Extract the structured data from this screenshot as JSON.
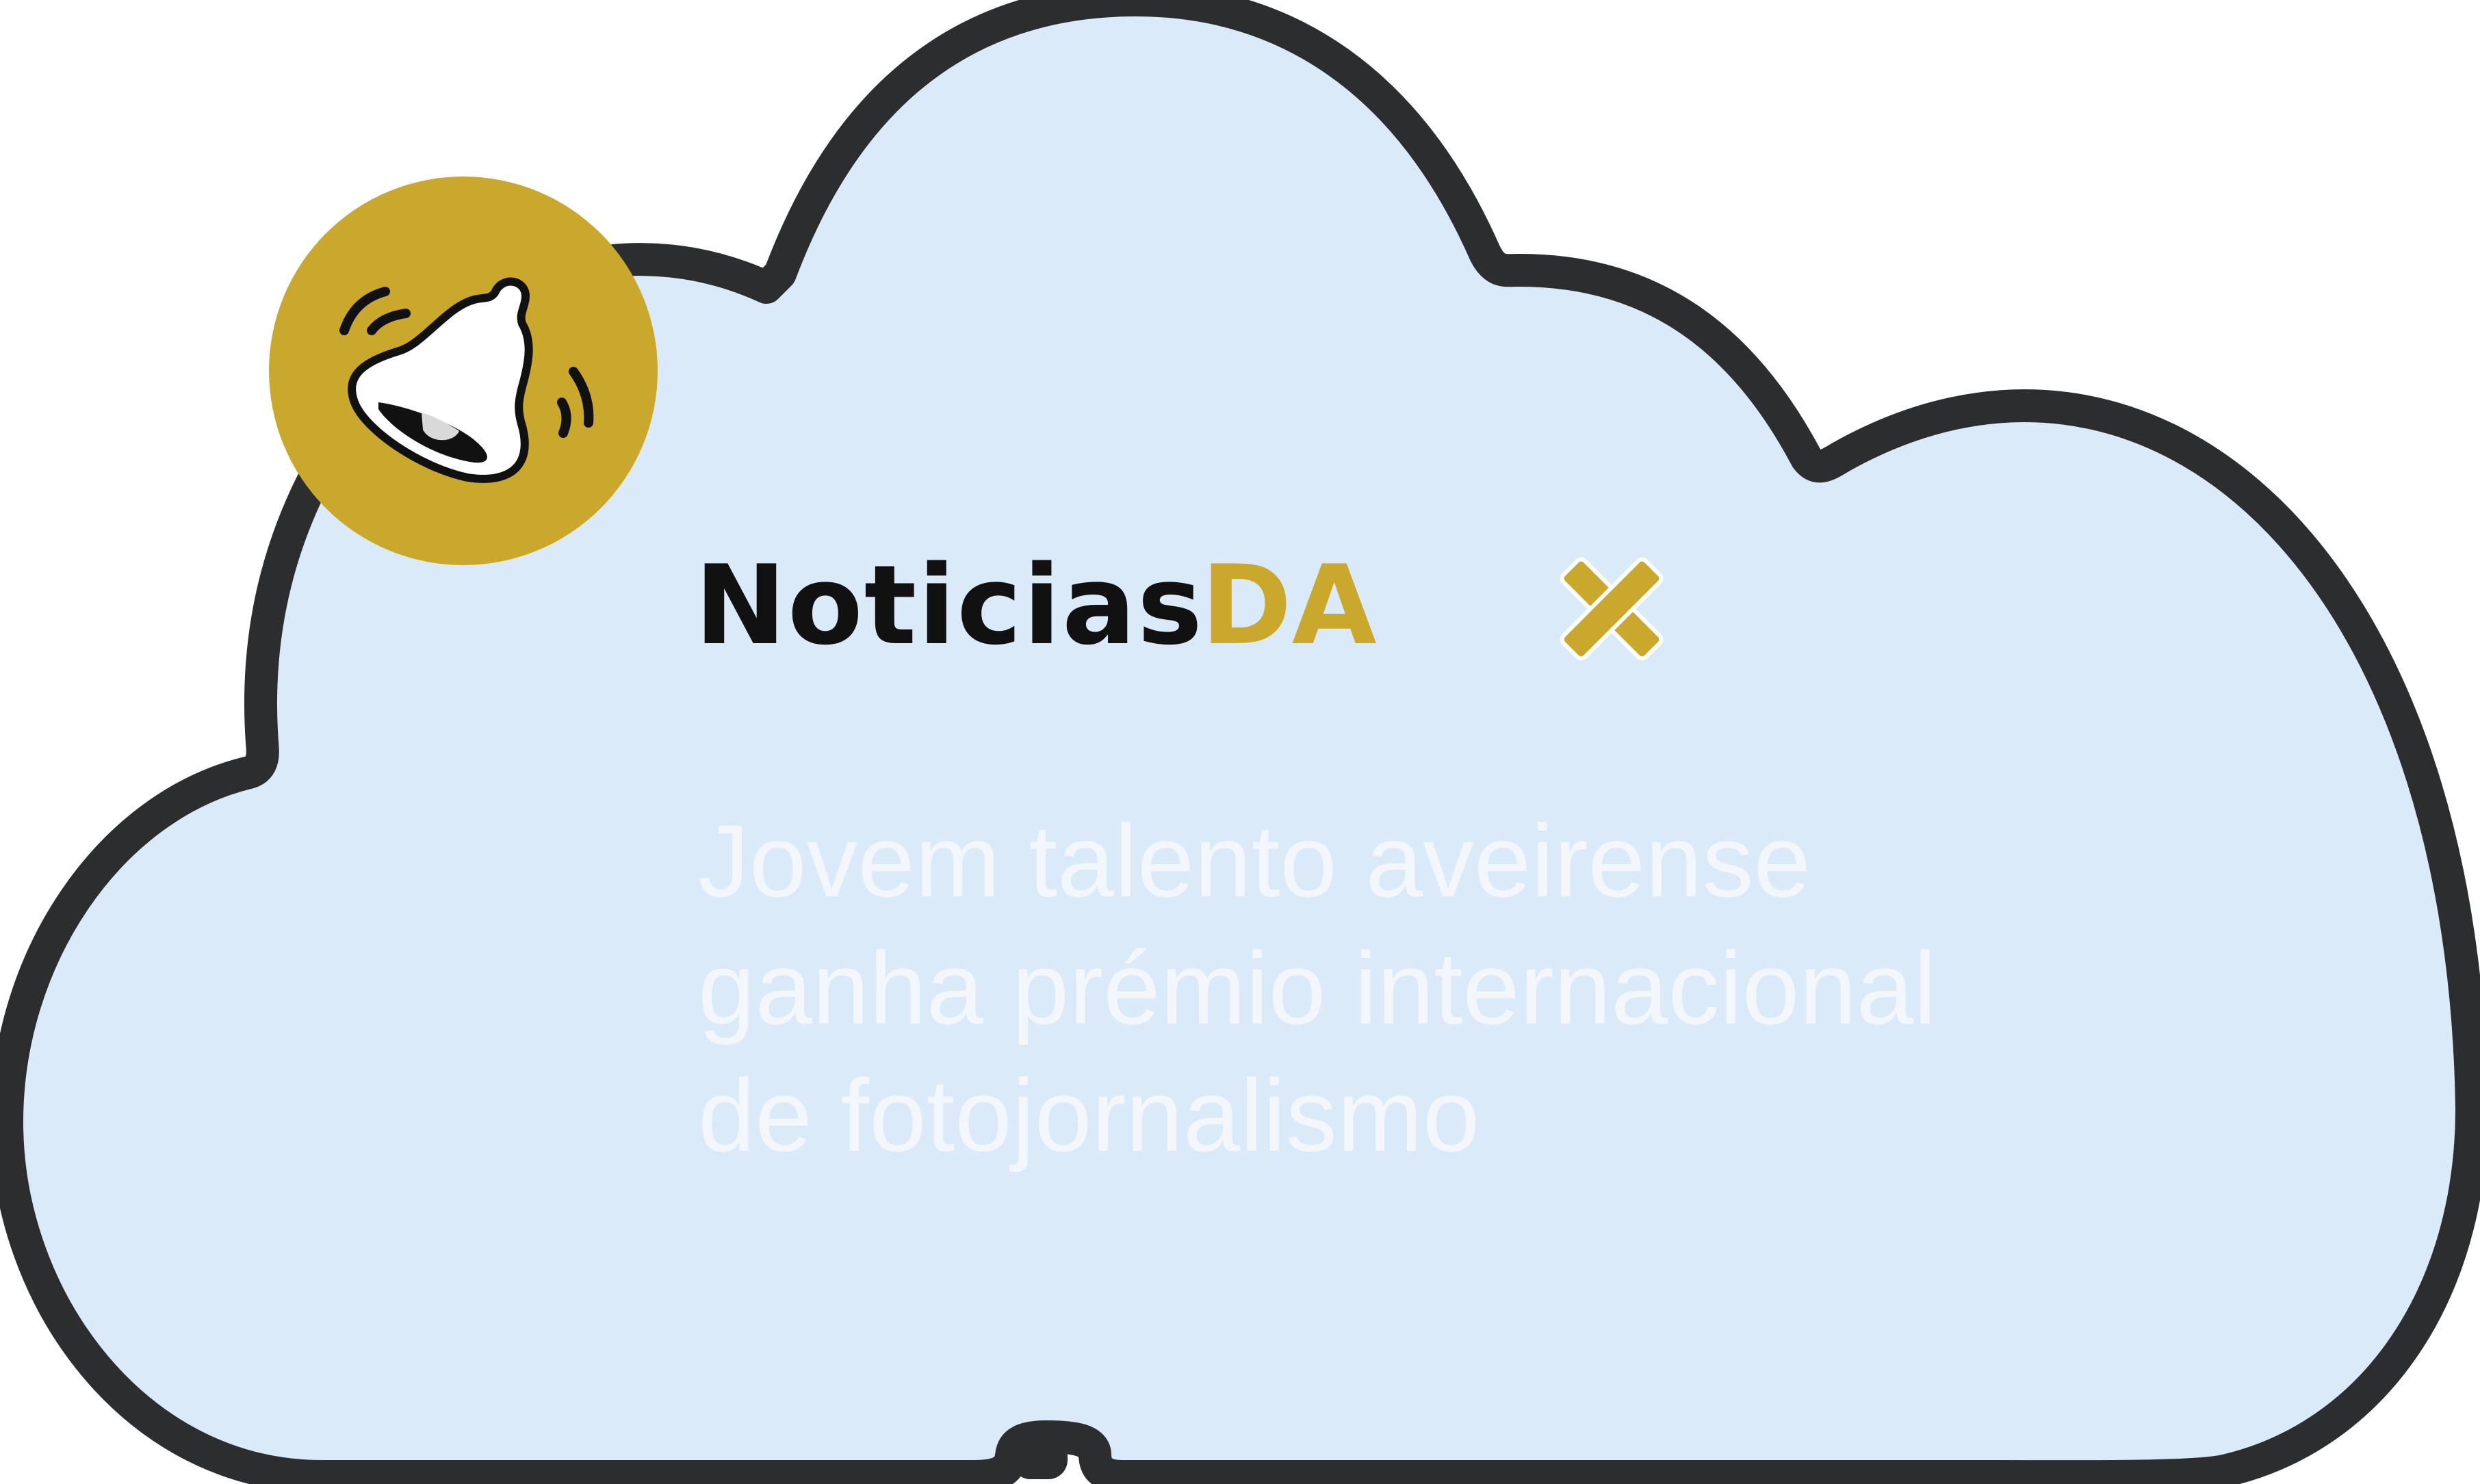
{
  "brand": {
    "word": "Noticias",
    "particle": "DA",
    "mark_label": ""
  },
  "headline": {
    "line1": "Jovem talento aveirense",
    "line2": "ganha prémio internacional",
    "line3": "de fotojornalismo"
  },
  "icons": {
    "badge": "bell-ringing-icon",
    "brand_mark": "x-mark-icon"
  },
  "colors": {
    "cloud_fill": "#daeaf9",
    "cloud_outline": "#2b2d2f",
    "accent_gold": "#c9a82b",
    "title_dark": "#111111",
    "headline_text": "#f3f7fb"
  }
}
